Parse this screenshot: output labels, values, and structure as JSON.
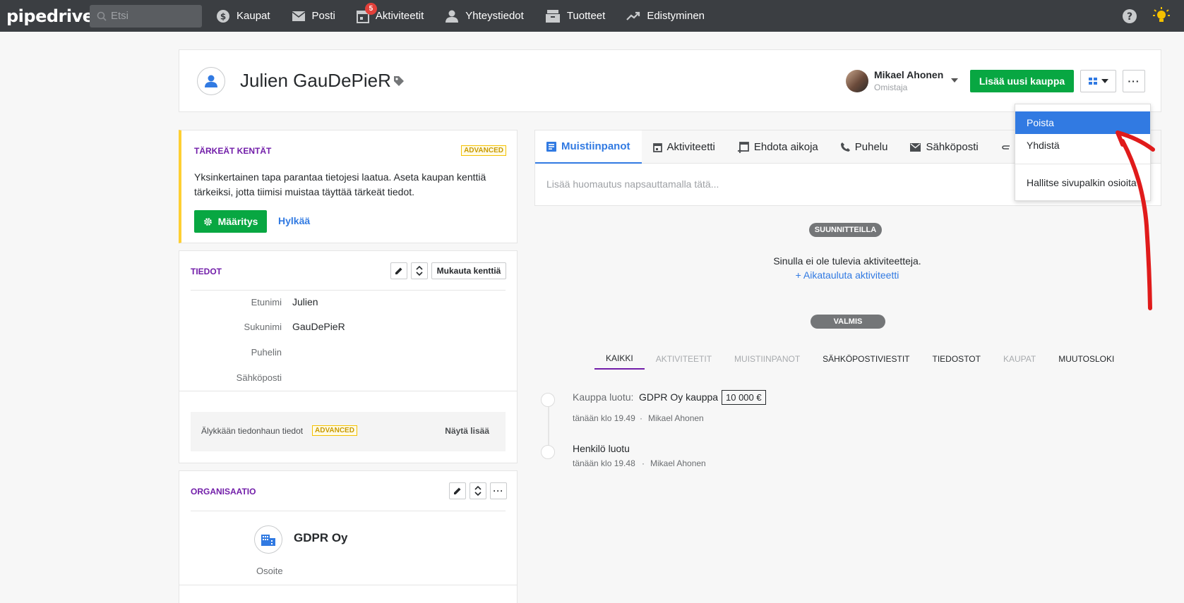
{
  "topbar": {
    "logo": "pipedrive",
    "search_placeholder": "Etsi",
    "nav": [
      {
        "label": "Kaupat",
        "icon": "dollar-icon"
      },
      {
        "label": "Posti",
        "icon": "mail-icon"
      },
      {
        "label": "Aktiviteetit",
        "icon": "calendar-icon",
        "badge": "5"
      },
      {
        "label": "Yhteystiedot",
        "icon": "person-icon"
      },
      {
        "label": "Tuotteet",
        "icon": "box-icon"
      },
      {
        "label": "Edistyminen",
        "icon": "trend-icon"
      }
    ]
  },
  "header": {
    "person_name": "Julien GauDePieR",
    "owner_name": "Mikael Ahonen",
    "owner_role": "Omistaja",
    "add_deal_label": "Lisää uusi kauppa",
    "more_label": "···"
  },
  "dropdown": {
    "items": [
      "Poista",
      "Yhdistä",
      "Hallitse sivupalkin osioita"
    ]
  },
  "important": {
    "title": "TÄRKEÄT KENTÄT",
    "badge": "ADVANCED",
    "text": "Yksinkertainen tapa parantaa tietojesi laatua. Aseta kaupan kenttiä tärkeiksi, jotta tiimisi muistaa täyttää tärkeät tiedot.",
    "setup_label": "Määritys",
    "reject_label": "Hylkää"
  },
  "details": {
    "title": "TIEDOT",
    "customize_label": "Mukauta kenttiä",
    "fields": [
      {
        "label": "Etunimi",
        "value": "Julien"
      },
      {
        "label": "Sukunimi",
        "value": "GauDePieR"
      },
      {
        "label": "Puhelin",
        "value": ""
      },
      {
        "label": "Sähköposti",
        "value": ""
      }
    ],
    "smart_label": "Älykkään tiedonhaun tiedot",
    "smart_badge": "ADVANCED",
    "show_more": "Näytä lisää"
  },
  "org": {
    "title": "ORGANISAATIO",
    "name": "GDPR Oy",
    "address_label": "Osoite"
  },
  "composer": {
    "tabs": [
      "Muistiinpanot",
      "Aktiviteetti",
      "Ehdota aikoja",
      "Puhelu",
      "Sähköposti"
    ],
    "placeholder": "Lisää huomautus napsauttamalla tätä..."
  },
  "planned": {
    "pill": "SUUNNITTEILLA",
    "empty_text": "Sinulla ei ole tulevia aktiviteetteja.",
    "schedule_link": "+ Aikatauluta aktiviteetti"
  },
  "done": {
    "pill": "VALMIS",
    "filters": [
      "KAIKKI",
      "AKTIVITEETIT",
      "MUISTIINPANOT",
      "SÄHKÖPOSTIVIESTIT",
      "TIEDOSTOT",
      "KAUPAT",
      "MUUTOSLOKI"
    ]
  },
  "timeline": [
    {
      "prefix": "Kauppa luotu:",
      "title": "GDPR Oy kauppa",
      "amount": "10 000 €",
      "time": "tänään klo 19.49",
      "sep": "·",
      "user": "Mikael Ahonen"
    },
    {
      "prefix": "",
      "title": "Henkilö luotu",
      "amount": "",
      "time": "tänään klo 19.48",
      "sep": "·",
      "user": "Mikael Ahonen"
    }
  ],
  "colors": {
    "accent": "#317ae2",
    "green": "#08a742",
    "topbar": "#3b3e42",
    "annotation": "#e01b1b"
  }
}
